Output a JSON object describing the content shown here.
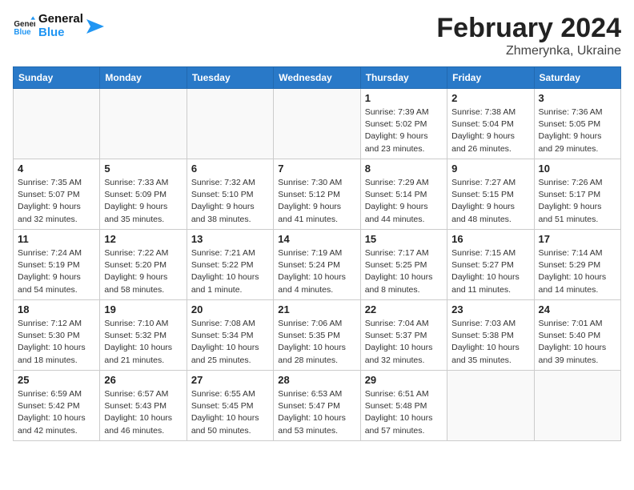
{
  "header": {
    "logo_general": "General",
    "logo_blue": "Blue",
    "month_year": "February 2024",
    "location": "Zhmerynka, Ukraine"
  },
  "columns": [
    "Sunday",
    "Monday",
    "Tuesday",
    "Wednesday",
    "Thursday",
    "Friday",
    "Saturday"
  ],
  "weeks": [
    [
      {
        "day": "",
        "info": ""
      },
      {
        "day": "",
        "info": ""
      },
      {
        "day": "",
        "info": ""
      },
      {
        "day": "",
        "info": ""
      },
      {
        "day": "1",
        "info": "Sunrise: 7:39 AM\nSunset: 5:02 PM\nDaylight: 9 hours\nand 23 minutes."
      },
      {
        "day": "2",
        "info": "Sunrise: 7:38 AM\nSunset: 5:04 PM\nDaylight: 9 hours\nand 26 minutes."
      },
      {
        "day": "3",
        "info": "Sunrise: 7:36 AM\nSunset: 5:05 PM\nDaylight: 9 hours\nand 29 minutes."
      }
    ],
    [
      {
        "day": "4",
        "info": "Sunrise: 7:35 AM\nSunset: 5:07 PM\nDaylight: 9 hours\nand 32 minutes."
      },
      {
        "day": "5",
        "info": "Sunrise: 7:33 AM\nSunset: 5:09 PM\nDaylight: 9 hours\nand 35 minutes."
      },
      {
        "day": "6",
        "info": "Sunrise: 7:32 AM\nSunset: 5:10 PM\nDaylight: 9 hours\nand 38 minutes."
      },
      {
        "day": "7",
        "info": "Sunrise: 7:30 AM\nSunset: 5:12 PM\nDaylight: 9 hours\nand 41 minutes."
      },
      {
        "day": "8",
        "info": "Sunrise: 7:29 AM\nSunset: 5:14 PM\nDaylight: 9 hours\nand 44 minutes."
      },
      {
        "day": "9",
        "info": "Sunrise: 7:27 AM\nSunset: 5:15 PM\nDaylight: 9 hours\nand 48 minutes."
      },
      {
        "day": "10",
        "info": "Sunrise: 7:26 AM\nSunset: 5:17 PM\nDaylight: 9 hours\nand 51 minutes."
      }
    ],
    [
      {
        "day": "11",
        "info": "Sunrise: 7:24 AM\nSunset: 5:19 PM\nDaylight: 9 hours\nand 54 minutes."
      },
      {
        "day": "12",
        "info": "Sunrise: 7:22 AM\nSunset: 5:20 PM\nDaylight: 9 hours\nand 58 minutes."
      },
      {
        "day": "13",
        "info": "Sunrise: 7:21 AM\nSunset: 5:22 PM\nDaylight: 10 hours\nand 1 minute."
      },
      {
        "day": "14",
        "info": "Sunrise: 7:19 AM\nSunset: 5:24 PM\nDaylight: 10 hours\nand 4 minutes."
      },
      {
        "day": "15",
        "info": "Sunrise: 7:17 AM\nSunset: 5:25 PM\nDaylight: 10 hours\nand 8 minutes."
      },
      {
        "day": "16",
        "info": "Sunrise: 7:15 AM\nSunset: 5:27 PM\nDaylight: 10 hours\nand 11 minutes."
      },
      {
        "day": "17",
        "info": "Sunrise: 7:14 AM\nSunset: 5:29 PM\nDaylight: 10 hours\nand 14 minutes."
      }
    ],
    [
      {
        "day": "18",
        "info": "Sunrise: 7:12 AM\nSunset: 5:30 PM\nDaylight: 10 hours\nand 18 minutes."
      },
      {
        "day": "19",
        "info": "Sunrise: 7:10 AM\nSunset: 5:32 PM\nDaylight: 10 hours\nand 21 minutes."
      },
      {
        "day": "20",
        "info": "Sunrise: 7:08 AM\nSunset: 5:34 PM\nDaylight: 10 hours\nand 25 minutes."
      },
      {
        "day": "21",
        "info": "Sunrise: 7:06 AM\nSunset: 5:35 PM\nDaylight: 10 hours\nand 28 minutes."
      },
      {
        "day": "22",
        "info": "Sunrise: 7:04 AM\nSunset: 5:37 PM\nDaylight: 10 hours\nand 32 minutes."
      },
      {
        "day": "23",
        "info": "Sunrise: 7:03 AM\nSunset: 5:38 PM\nDaylight: 10 hours\nand 35 minutes."
      },
      {
        "day": "24",
        "info": "Sunrise: 7:01 AM\nSunset: 5:40 PM\nDaylight: 10 hours\nand 39 minutes."
      }
    ],
    [
      {
        "day": "25",
        "info": "Sunrise: 6:59 AM\nSunset: 5:42 PM\nDaylight: 10 hours\nand 42 minutes."
      },
      {
        "day": "26",
        "info": "Sunrise: 6:57 AM\nSunset: 5:43 PM\nDaylight: 10 hours\nand 46 minutes."
      },
      {
        "day": "27",
        "info": "Sunrise: 6:55 AM\nSunset: 5:45 PM\nDaylight: 10 hours\nand 50 minutes."
      },
      {
        "day": "28",
        "info": "Sunrise: 6:53 AM\nSunset: 5:47 PM\nDaylight: 10 hours\nand 53 minutes."
      },
      {
        "day": "29",
        "info": "Sunrise: 6:51 AM\nSunset: 5:48 PM\nDaylight: 10 hours\nand 57 minutes."
      },
      {
        "day": "",
        "info": ""
      },
      {
        "day": "",
        "info": ""
      }
    ]
  ]
}
